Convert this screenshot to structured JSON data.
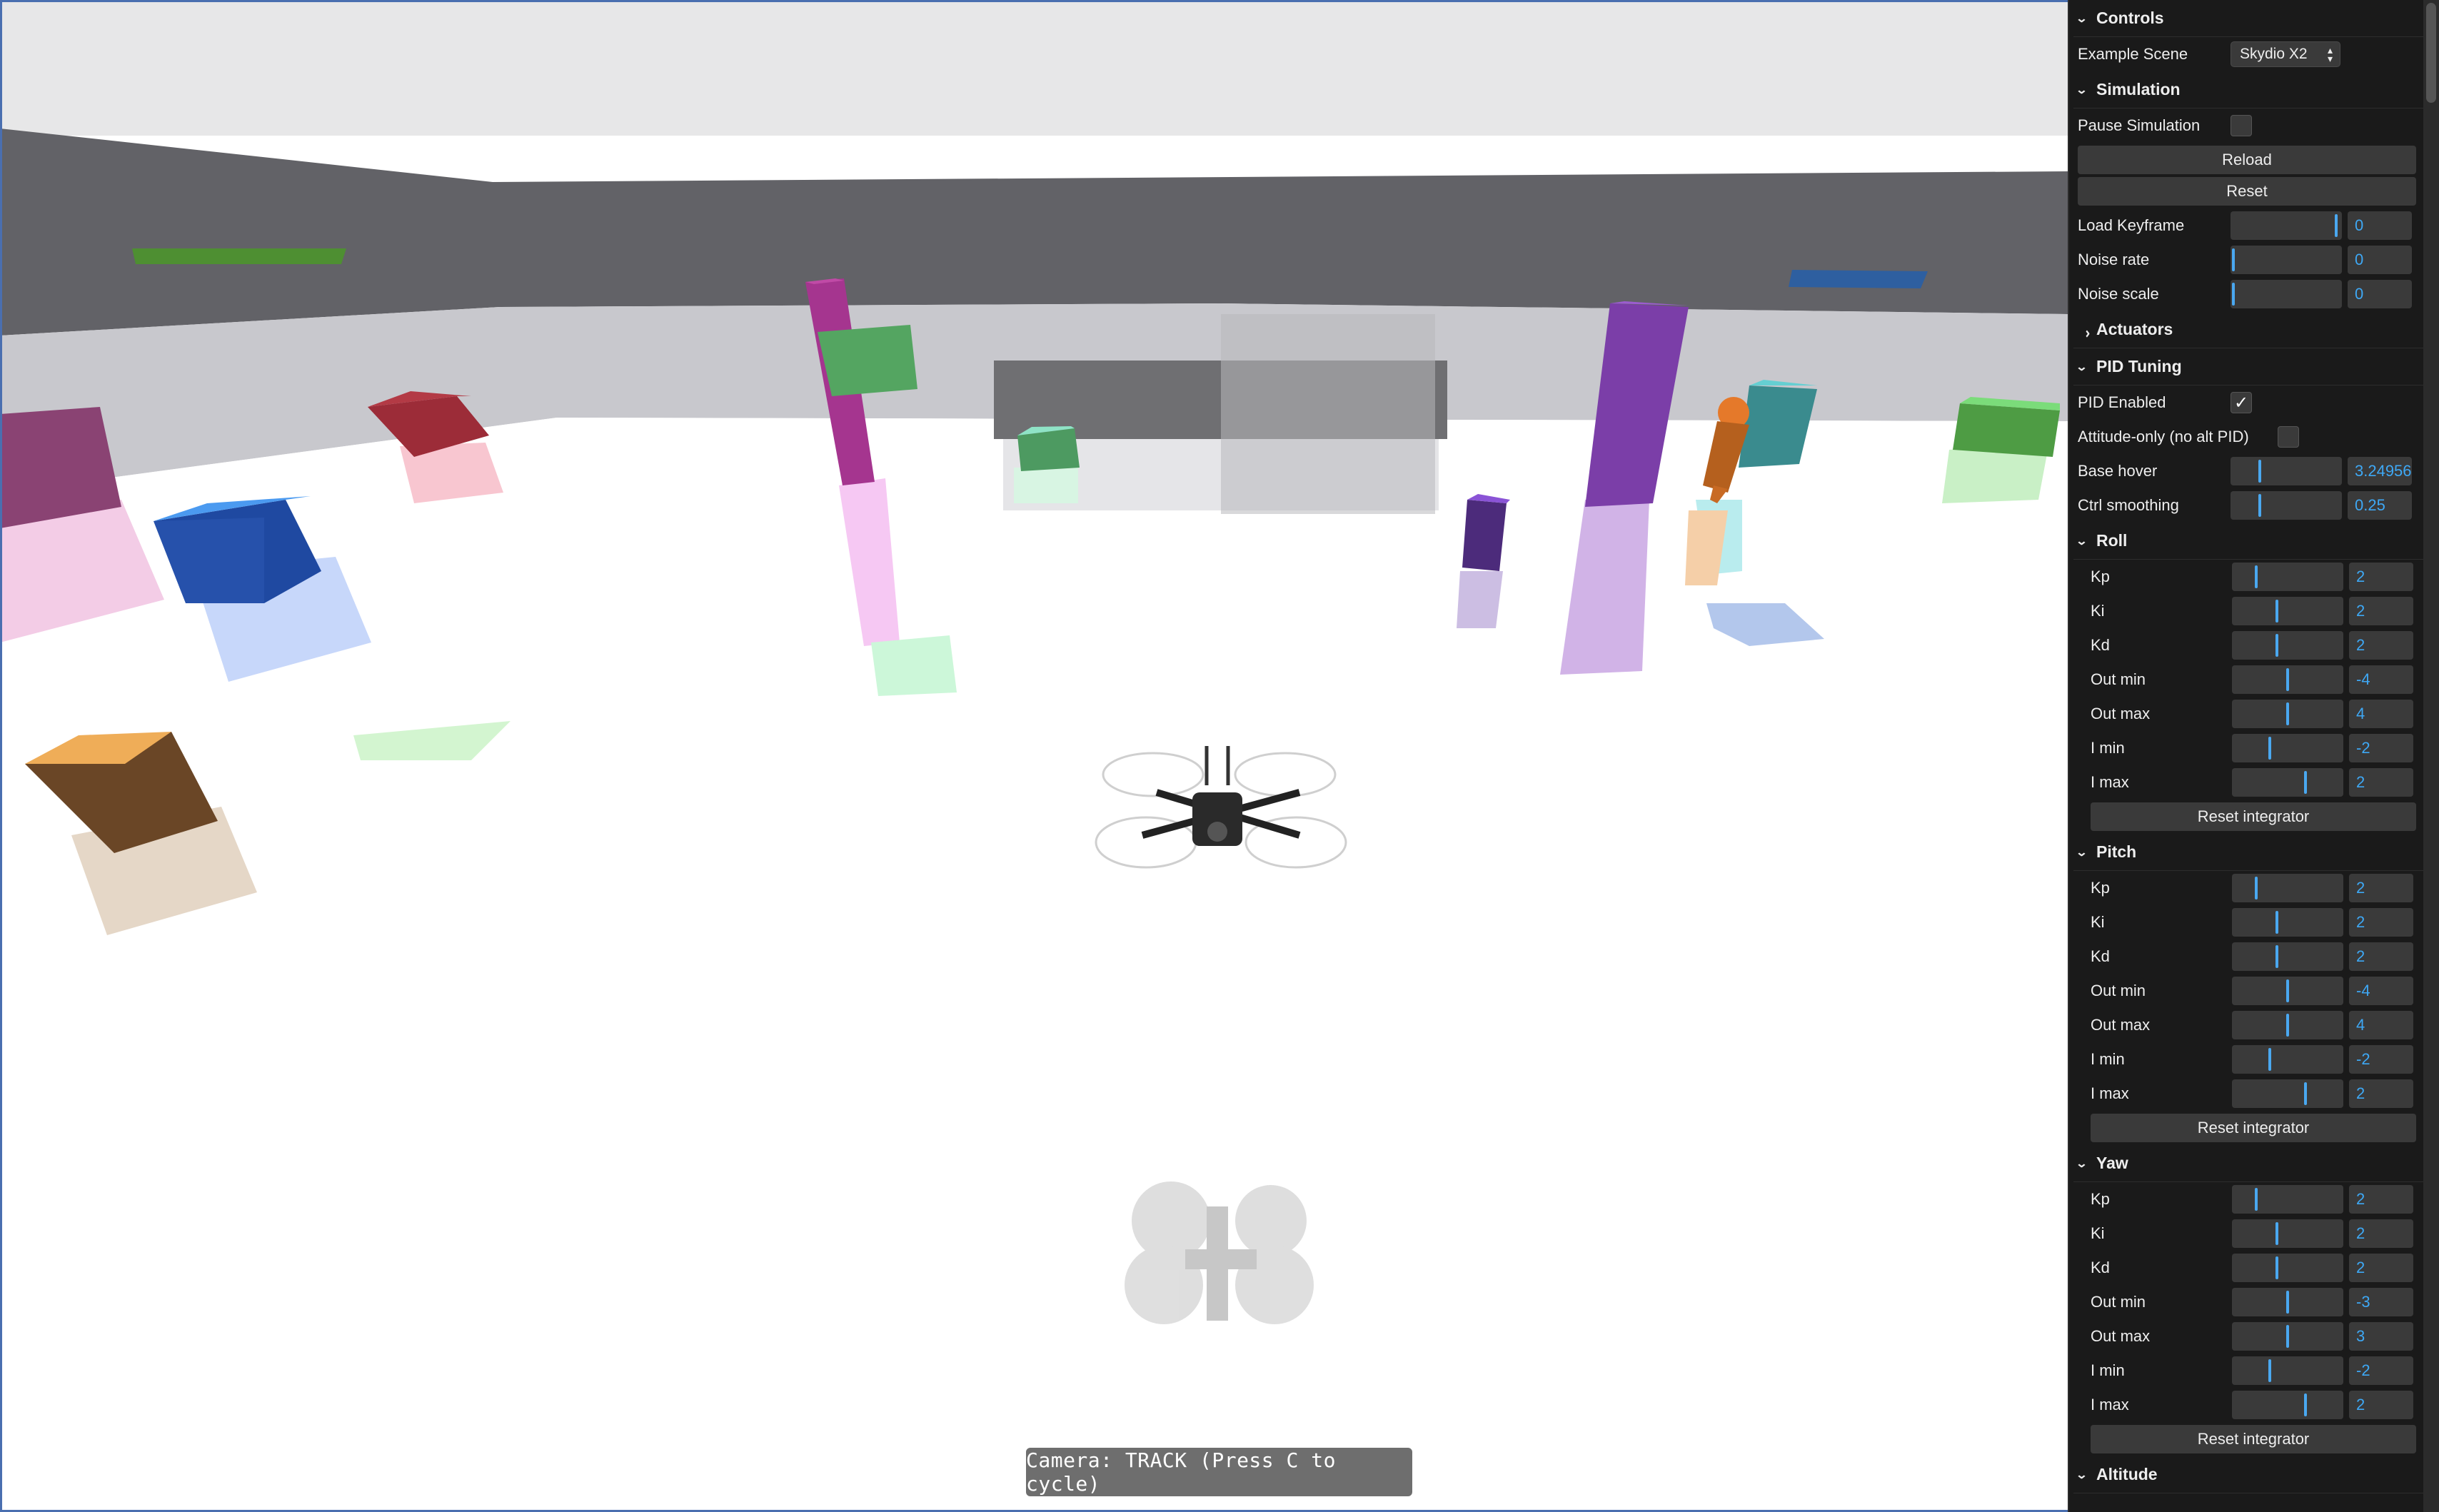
{
  "viewport": {
    "camera_label": "Camera: TRACK (Press C to cycle)"
  },
  "panel": {
    "title": "Controls",
    "example_scene": {
      "label": "Example Scene",
      "value": "Skydio X2"
    },
    "simulation": {
      "title": "Simulation",
      "pause": {
        "label": "Pause Simulation",
        "checked": false
      },
      "reload_label": "Reload",
      "reset_label": "Reset",
      "load_keyframe": {
        "label": "Load Keyframe",
        "value": "0",
        "level": 0.97
      },
      "noise_rate": {
        "label": "Noise rate",
        "value": "0",
        "level": 0.0
      },
      "noise_scale": {
        "label": "Noise scale",
        "value": "0",
        "level": 0.0
      }
    },
    "actuators": {
      "title": "Actuators",
      "expanded": false
    },
    "pid_tuning": {
      "title": "PID Tuning",
      "pid_enabled": {
        "label": "PID Enabled",
        "checked": true,
        "check_glyph": "✓"
      },
      "attitude_only": {
        "label": "Attitude-only (no alt PID)",
        "checked": false
      },
      "base_hover": {
        "label": "Base hover",
        "value": "3.24956",
        "level": 0.25
      },
      "ctrl_smoothing": {
        "label": "Ctrl smoothing",
        "value": "0.25",
        "level": 0.25
      }
    },
    "roll": {
      "title": "Roll",
      "params": [
        {
          "label": "Kp",
          "value": "2",
          "level": 0.2
        },
        {
          "label": "Ki",
          "value": "2",
          "level": 0.4
        },
        {
          "label": "Kd",
          "value": "2",
          "level": 0.4
        },
        {
          "label": "Out min",
          "value": "-4",
          "level": 0.5
        },
        {
          "label": "Out max",
          "value": "4",
          "level": 0.5
        },
        {
          "label": "I min",
          "value": "-2",
          "level": 0.33
        },
        {
          "label": "I max",
          "value": "2",
          "level": 0.67
        }
      ],
      "reset_label": "Reset integrator"
    },
    "pitch": {
      "title": "Pitch",
      "params": [
        {
          "label": "Kp",
          "value": "2",
          "level": 0.2
        },
        {
          "label": "Ki",
          "value": "2",
          "level": 0.4
        },
        {
          "label": "Kd",
          "value": "2",
          "level": 0.4
        },
        {
          "label": "Out min",
          "value": "-4",
          "level": 0.5
        },
        {
          "label": "Out max",
          "value": "4",
          "level": 0.5
        },
        {
          "label": "I min",
          "value": "-2",
          "level": 0.33
        },
        {
          "label": "I max",
          "value": "2",
          "level": 0.67
        }
      ],
      "reset_label": "Reset integrator"
    },
    "yaw": {
      "title": "Yaw",
      "params": [
        {
          "label": "Kp",
          "value": "2",
          "level": 0.2
        },
        {
          "label": "Ki",
          "value": "2",
          "level": 0.4
        },
        {
          "label": "Kd",
          "value": "2",
          "level": 0.4
        },
        {
          "label": "Out min",
          "value": "-3",
          "level": 0.5
        },
        {
          "label": "Out max",
          "value": "3",
          "level": 0.5
        },
        {
          "label": "I min",
          "value": "-2",
          "level": 0.33
        },
        {
          "label": "I max",
          "value": "2",
          "level": 0.67
        }
      ],
      "reset_label": "Reset integrator"
    },
    "altitude": {
      "title": "Altitude"
    }
  },
  "colors": {
    "accent": "#3ea8f5",
    "panel_bg": "#1a1a1a",
    "control_bg": "#3a3a3a"
  }
}
